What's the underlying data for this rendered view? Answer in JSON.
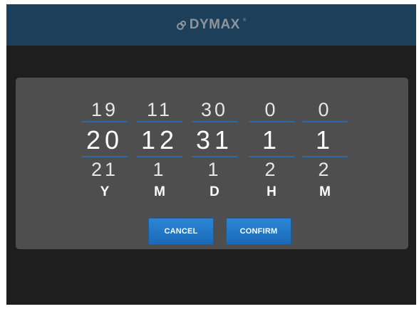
{
  "header": {
    "brand": "DYMAX",
    "trademark": "®"
  },
  "picker": {
    "columns": [
      {
        "id": "year",
        "prev": "19",
        "selected": "20",
        "next": "21",
        "unit": "Y"
      },
      {
        "id": "month",
        "prev": "11",
        "selected": "12",
        "next": "1",
        "unit": "M"
      },
      {
        "id": "day",
        "prev": "30",
        "selected": "31",
        "next": "1",
        "unit": "D"
      },
      {
        "id": "hour",
        "prev": "0",
        "selected": "1",
        "next": "2",
        "unit": "H"
      },
      {
        "id": "minute",
        "prev": "0",
        "selected": "1",
        "next": "2",
        "unit": "M"
      }
    ]
  },
  "buttons": {
    "cancel": "CANCEL",
    "confirm": "CONFIRM"
  },
  "colors": {
    "header_bg": "#1d3f5a",
    "screen_bg": "#1e1e1e",
    "dialog_bg": "#4e4e4e",
    "accent": "#2a86d6",
    "separator": "#2c6aa6"
  },
  "icons": {
    "logo": "dymax-logo-icon"
  }
}
